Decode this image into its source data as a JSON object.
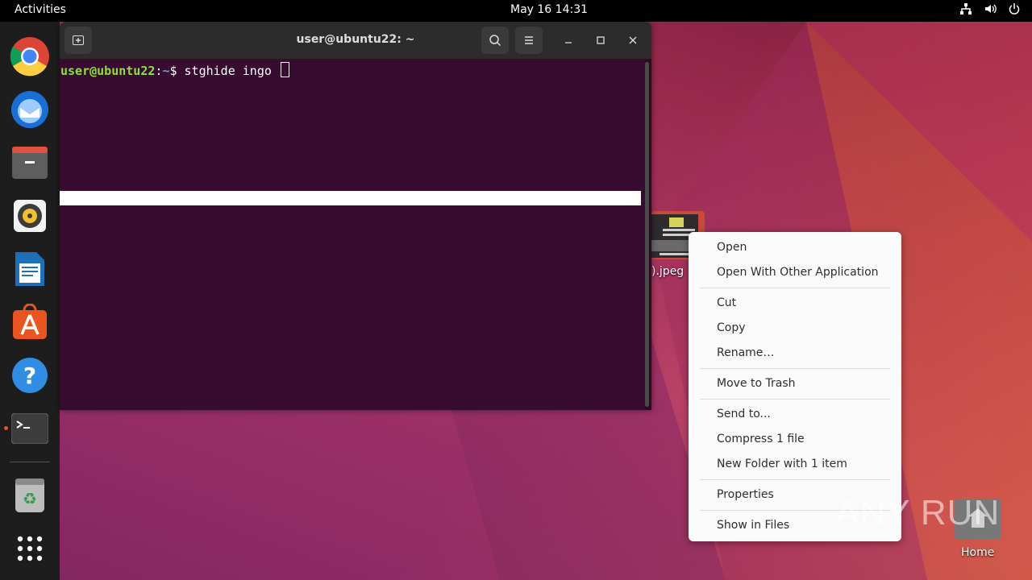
{
  "topbar": {
    "activities": "Activities",
    "clock": "May 16  14:31",
    "tray_icons": [
      "network-icon",
      "volume-icon",
      "power-icon"
    ]
  },
  "dock": {
    "items": [
      {
        "name": "chrome-icon"
      },
      {
        "name": "thunderbird-icon"
      },
      {
        "name": "files-icon"
      },
      {
        "name": "rhythmbox-icon"
      },
      {
        "name": "libreoffice-writer-icon"
      },
      {
        "name": "app-center-icon"
      },
      {
        "name": "help-icon"
      },
      {
        "name": "terminal-icon",
        "running": true
      },
      {
        "name": "trash-icon"
      },
      {
        "name": "show-apps-icon"
      }
    ]
  },
  "terminal": {
    "title": "user@ubuntu22: ~",
    "prompt_user": "user@ubuntu22",
    "prompt_sep": ":",
    "prompt_dir": "~",
    "prompt_symbol": "$ ",
    "command": "stghide ingo "
  },
  "desktop": {
    "file_label": ").jpeg",
    "home_label": "Home"
  },
  "context_menu": {
    "items": [
      "Open",
      "Open With Other Application",
      "Cut",
      "Copy",
      "Rename…",
      "Move to Trash",
      "Send to...",
      "Compress 1 file",
      "New Folder with 1 item",
      "Properties",
      "Show in Files"
    ]
  },
  "watermark": "ANY RUN",
  "colors": {
    "accent": "#e95420",
    "terminal_bg": "#380c30",
    "prompt_user": "#8ae234",
    "prompt_dir": "#729fcf"
  }
}
